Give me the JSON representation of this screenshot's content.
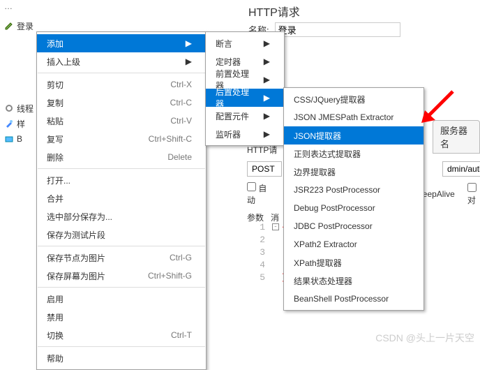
{
  "toolbar_clip": "…",
  "tree": {
    "root_label": "登录",
    "thread_label": "线程",
    "sampler1": "样",
    "sampler2": "B"
  },
  "menu1": {
    "add": "添加",
    "insert_parent": "插入上级",
    "cut": "剪切",
    "cut_sc": "Ctrl-X",
    "copy": "复制",
    "copy_sc": "Ctrl-C",
    "paste": "粘贴",
    "paste_sc": "Ctrl-V",
    "duplicate": "复写",
    "duplicate_sc": "Ctrl+Shift-C",
    "delete": "删除",
    "delete_sc": "Delete",
    "open": "打开...",
    "merge": "合并",
    "save_selection_as": "选中部分保存为...",
    "save_as_test_fragment": "保存为测试片段",
    "save_node_as_image": "保存节点为图片",
    "save_node_sc": "Ctrl-G",
    "save_screen_as_image": "保存屏幕为图片",
    "save_screen_sc": "Ctrl+Shift-G",
    "enable": "启用",
    "disable": "禁用",
    "toggle": "切换",
    "toggle_sc": "Ctrl-T",
    "help": "帮助"
  },
  "menu2": {
    "assertions": "断言",
    "timer": "定时器",
    "pre_processors": "前置处理器",
    "post_processors": "后置处理器",
    "config_element": "配置元件",
    "listener": "监听器"
  },
  "menu3": {
    "css_jquery": "CSS/JQuery提取器",
    "json_jmespath": "JSON JMESPath Extractor",
    "json_extractor": "JSON提取器",
    "regex_extractor": "正则表达式提取器",
    "boundary_extractor": "边界提取器",
    "jsr223": "JSR223 PostProcessor",
    "debug": "Debug PostProcessor",
    "jdbc": "JDBC PostProcessor",
    "xpath2": "XPath2 Extractor",
    "xpath": "XPath提取器",
    "result_status": "结果状态处理器",
    "beanshell": "BeanShell PostProcessor"
  },
  "right": {
    "title": "HTTP请求",
    "name_label": "名称:",
    "name_value": "登录",
    "server_tab": "服务器名",
    "http_req_label": "HTTP请",
    "method": "POST",
    "path": "dmin/auth/lo",
    "auto_redirect": "自动",
    "keepalive": "eepAlive",
    "multipart": "对",
    "params_tab": "参数",
    "body_tab": "消"
  },
  "editor_lines": [
    "1",
    "2",
    "3",
    "4",
    "5"
  ],
  "watermark": "CSDN @头上一片天空"
}
